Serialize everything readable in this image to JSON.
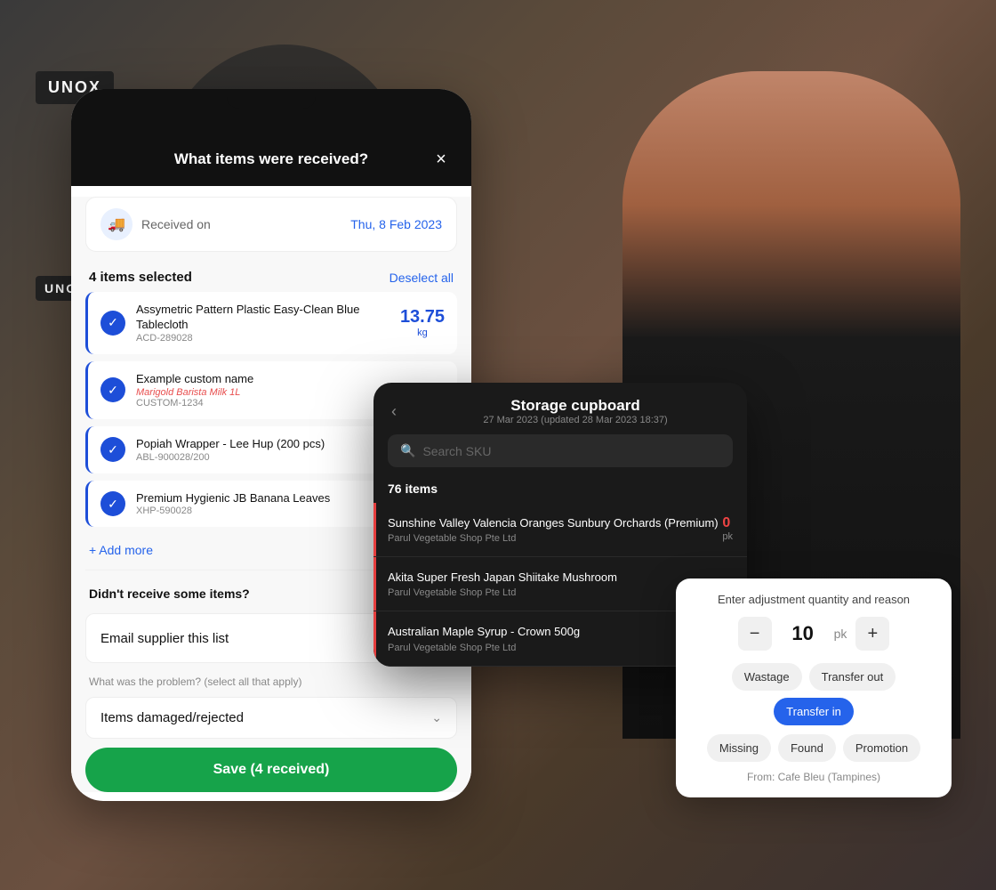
{
  "background": {
    "unox1": "UNOX",
    "unox2": "UNOX"
  },
  "phone": {
    "header_title": "What items were received?",
    "close_label": "×",
    "received_label": "Received on",
    "received_date": "Thu, 8 Feb 2023",
    "items_selected": "4 items selected",
    "deselect_all": "Deselect all",
    "items": [
      {
        "name": "Assymetric Pattern Plastic Easy-Clean Blue Tablecloth",
        "sku": "ACD-289028",
        "qty": "13.75",
        "unit": "kg",
        "custom_name": null
      },
      {
        "name": "Example custom name",
        "sku": "CUSTOM-1234",
        "qty": null,
        "unit": null,
        "custom_name": "Marigold Barista Milk 1L"
      },
      {
        "name": "Popiah Wrapper - Lee Hup (200 pcs)",
        "sku": "ABL-900028/200",
        "qty": null,
        "unit": null,
        "custom_name": null
      },
      {
        "name": "Premium Hygienic JB Banana Leaves",
        "sku": "XHP-590028",
        "qty": null,
        "unit": null,
        "custom_name": null
      }
    ],
    "add_more": "+ Add more",
    "didnt_receive": "Didn't receive some items?",
    "email_supplier": "Email supplier this list",
    "problem_label": "What was the problem? (select all that apply)",
    "items_damaged": "Items damaged/rejected",
    "save_button": "Save (4 received)"
  },
  "storage": {
    "back_icon": "‹",
    "title": "Storage cupboard",
    "subtitle": "27 Mar 2023 (updated 28 Mar 2023 18:37)",
    "search_placeholder": "Search SKU",
    "items_total": "76 items",
    "items": [
      {
        "name": "Sunshine Valley Valencia Oranges Sunbury Orchards (Premium)",
        "supplier": "Parul Vegetable Shop Pte Ltd",
        "qty": "0",
        "unit": "pk"
      },
      {
        "name": "Akita Super Fresh Japan Shiitake Mushroom",
        "supplier": "Parul Vegetable Shop Pte Ltd",
        "qty": null,
        "unit": null
      },
      {
        "name": "Australian Maple Syrup - Crown 500g",
        "supplier": "Parul Vegetable Shop Pte Ltd",
        "qty": null,
        "unit": null
      }
    ]
  },
  "adjustment": {
    "title": "Enter adjustment quantity and reason",
    "qty": "10",
    "unit": "pk",
    "minus_label": "−",
    "plus_label": "+",
    "reasons": [
      {
        "label": "Wastage",
        "active": false
      },
      {
        "label": "Transfer out",
        "active": false
      },
      {
        "label": "Transfer in",
        "active": true
      },
      {
        "label": "Missing",
        "active": false
      },
      {
        "label": "Found",
        "active": false
      },
      {
        "label": "Promotion",
        "active": false
      }
    ],
    "from_label": "From: Cafe Bleu (Tampines)"
  }
}
